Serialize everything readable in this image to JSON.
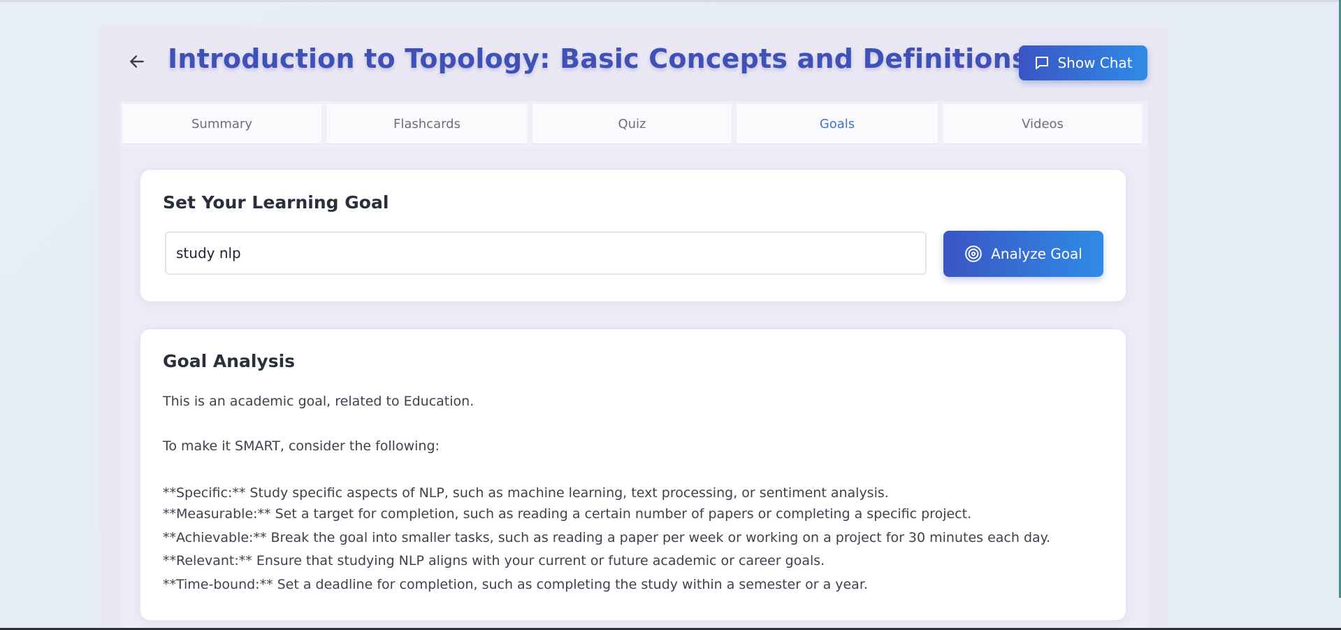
{
  "header": {
    "title": "Introduction to Topology: Basic Concepts and Definitions",
    "show_chat_label": "Show Chat"
  },
  "tabs": [
    {
      "label": "Summary",
      "active": false
    },
    {
      "label": "Flashcards",
      "active": false
    },
    {
      "label": "Quiz",
      "active": false
    },
    {
      "label": "Goals",
      "active": true
    },
    {
      "label": "Videos",
      "active": false
    }
  ],
  "goal_card": {
    "title": "Set Your Learning Goal",
    "input_value": "study nlp",
    "analyze_label": "Analyze Goal"
  },
  "analysis_card": {
    "title": "Goal Analysis",
    "intro": "This is an academic goal, related to Education.",
    "smart_intro": "To make it SMART, consider the following:",
    "points": [
      "**Specific:** Study specific aspects of NLP, such as machine learning, text processing, or sentiment analysis.",
      "**Measurable:** Set a target for completion, such as reading a certain number of papers or completing a specific project.",
      "**Achievable:** Break the goal into smaller tasks, such as reading a paper per week or working on a project for 30 minutes each day.",
      "**Relevant:** Ensure that studying NLP aligns with your current or future academic or career goals.",
      "**Time-bound:** Set a deadline for completion, such as completing the study within a semester or a year."
    ]
  },
  "colors": {
    "accent": "#3f51b5",
    "button_gradient_start": "#3a55c4",
    "button_gradient_end": "#2f8be6",
    "active_tab": "#3b74d6"
  },
  "icons": {
    "back": "arrow-left-icon",
    "chat": "chat-bubble-icon",
    "target": "target-icon"
  }
}
